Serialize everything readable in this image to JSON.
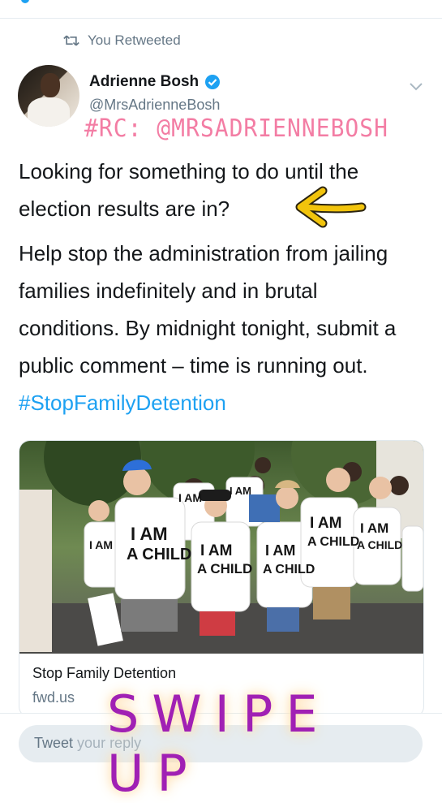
{
  "retweet": {
    "label": "You Retweeted"
  },
  "author": {
    "name": "Adrienne Bosh",
    "handle": "@MrsAdrienneBosh"
  },
  "overlay_credit": "#RC: @MRSADRIENNEBOSH",
  "tweet": {
    "paragraph1": "Looking for something to do until the election results are in?",
    "paragraph2": "Help stop the administration from jailing families indefinitely and in brutal conditions. By midnight tonight, submit a public comment – time is running out.",
    "hashtag": "#StopFamilyDetention"
  },
  "card": {
    "title": "Stop Family Detention",
    "domain": "fwd.us",
    "shirt_text_line1": "I AM",
    "shirt_text_line2": "A CHILD"
  },
  "reply": {
    "label": "Tweet",
    "placeholder": "your reply"
  },
  "overlay_cta": "SWIPE UP",
  "colors": {
    "link": "#1da1f2",
    "muted": "#657786",
    "credit_pink": "#f37da4",
    "cta_purple": "#a020b4",
    "arrow_yellow": "#f2c40c"
  },
  "icons": [
    "retweet-icon",
    "verified-icon",
    "chevron-down-icon",
    "yellow-arrow-sticker"
  ]
}
